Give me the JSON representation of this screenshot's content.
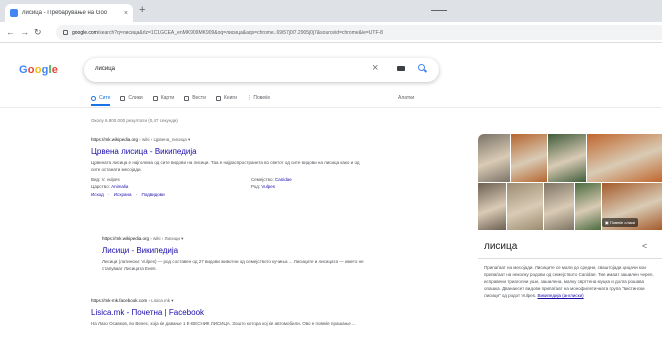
{
  "browser": {
    "tab_title": "лисица - Пребарување на Goo",
    "tab_close": "×",
    "new_tab": "+",
    "url_domain": "google.com",
    "url_rest": "/search?q=лисица&rlz=1C1GCEA_enMK909MK909&oq=лисица&aqs=chrome..69i57j0l7.2905j0j7&sourceid=chrome&ie=UTF-8"
  },
  "google": {
    "logo_letters": [
      "G",
      "o",
      "o",
      "g",
      "l",
      "e"
    ],
    "query": "лисица",
    "clear_glyph": "×",
    "tabs": [
      {
        "label": "Сите"
      },
      {
        "label": "Слики"
      },
      {
        "label": "Карти"
      },
      {
        "label": "Вести"
      },
      {
        "label": "Книги"
      },
      {
        "label": "⋮ Повеќе"
      }
    ],
    "tools_label": "Алатки",
    "stats": "Околу 6.800.000 резултати (0,47 секунди)"
  },
  "results": [
    {
      "cite": "https://mk.wikipedia.org",
      "cite_path": "› wiki › Црвена_лисица  ▾",
      "title": "Црвена лисица - Википедија",
      "snippet": "Црвената лисица е најголема од сите видови на лисици. Таа е најраспространета во светот од сите видови на лисица како и од сите останати месојади.",
      "facts": [
        {
          "k": "Вид:",
          "v": "V. vulpes"
        },
        {
          "k": "Семејство:",
          "v": "Canidae"
        },
        {
          "k": "Царство:",
          "v": "Animalia"
        },
        {
          "k": "Род:",
          "v": "Vulpes"
        }
      ],
      "sublinks": [
        "Исход",
        "Исхрана",
        "Подвидови"
      ]
    },
    {
      "cite": "https://mk.wikipedia.org",
      "cite_path": "› wiki › Лисици  ▾",
      "title": "Лисици - Википедија",
      "snippet": "Лисици (латински: Vulpes) — род составен од 27 видови животни од семејството кучиња ... Лисиците и лисицата — името не стапуваат Лисицата Енеп."
    },
    {
      "cite": "https://mk-mk.facebook.com",
      "cite_path": "› Lisica.mk  ▾",
      "title": "Lisica.mk - Почетна | Facebook",
      "snippet": "На Лазо Осавков, во Велес, која ќе давање 1 Е-ВЕСНИК ЛИСИЦА. Зошто котора кој ќе автомобили. Ово е повеќе прашање ..."
    }
  ],
  "knowledge_panel": {
    "title": "лисица",
    "more_images": "Повеќе слики",
    "description": "Припаѓаат на месојади. Лисиците се мали до средни, сваштојади цицачи кои припаѓаат на неколку родови од семејството Canidae. Тие имаат зашилен череп, исправени триаголни уши, зашилена, малку сврттена муцка и долга рошава опашка. Дванаесет видови припаѓаат на монофилетичната група \"вистински лисици\" од родот Vulpes.",
    "desc_link": "Википедија (англиски)",
    "colors": {
      "img1": "#7b7367",
      "img2": "#b5652f",
      "img3": "#3f5c3a",
      "img4": "#c0662c",
      "img5": "#6d5f52",
      "img6": "#9b8b72",
      "img7": "#7e7464",
      "img8": "#4b6b3f",
      "img9": "#a45a2a",
      "img10": "#545a4c"
    }
  }
}
